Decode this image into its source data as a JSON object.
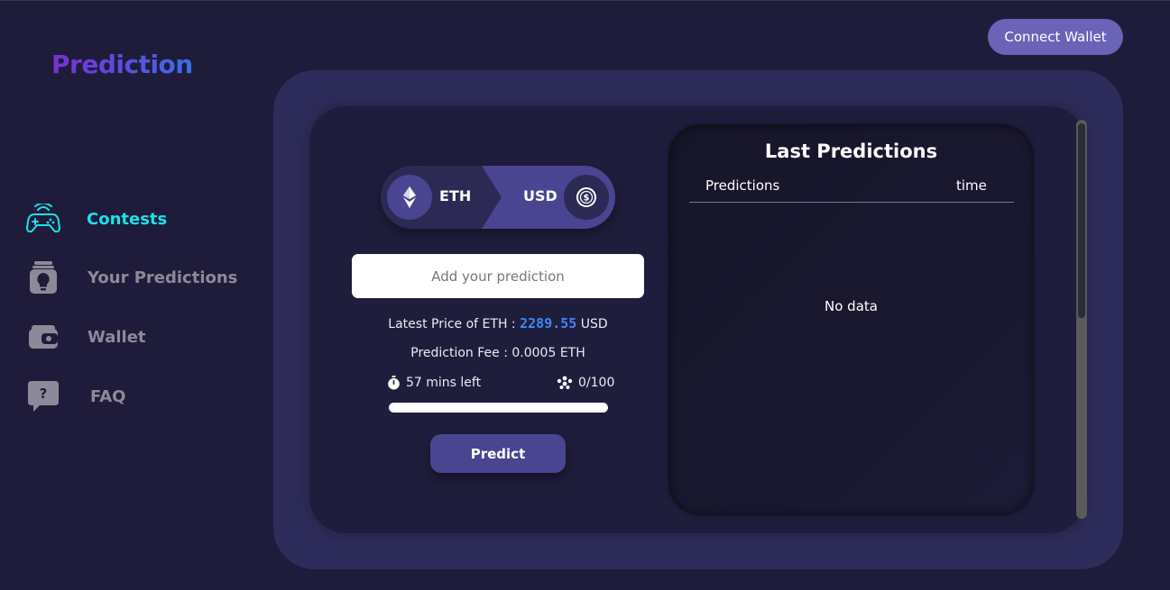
{
  "app": {
    "logo": "Prediction"
  },
  "header": {
    "connect_label": "Connect Wallet"
  },
  "sidebar": {
    "items": [
      {
        "label": "Contests",
        "icon": "gamepad-icon",
        "active": true
      },
      {
        "label": "Your Predictions",
        "icon": "jar-bulb-icon",
        "active": false
      },
      {
        "label": "Wallet",
        "icon": "wallet-icon",
        "active": false
      },
      {
        "label": "FAQ",
        "icon": "question-bubble-icon",
        "active": false
      }
    ]
  },
  "contest": {
    "base_token": "ETH",
    "base_icon": "ethereum-icon",
    "quote_token": "USD",
    "quote_icon": "dollar-coin-icon",
    "input_placeholder": "Add your prediction",
    "price_prefix": "Latest Price of ETH : ",
    "price_value": "2289.55",
    "price_unit": " USD",
    "fee_text": "Prediction Fee : 0.0005 ETH",
    "time_left": "57 mins left",
    "participants": "0/100",
    "progress_fraction": 0,
    "predict_label": "Predict"
  },
  "last_predictions": {
    "title": "Last Predictions",
    "columns": [
      "Predictions",
      "time"
    ],
    "empty_text": "No data"
  },
  "colors": {
    "background": "#1e1c3a",
    "accent": "#6a63b8",
    "active_nav": "#1be1ea",
    "price_highlight": "#3f87f5"
  }
}
